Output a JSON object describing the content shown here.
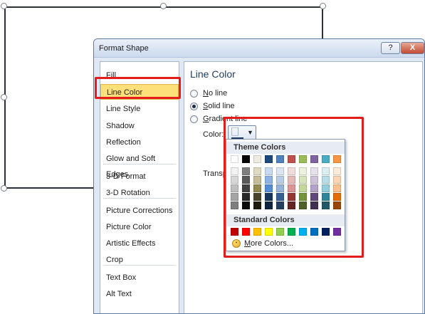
{
  "dialog": {
    "title": "Format Shape",
    "help_label": "?",
    "close_label": "X"
  },
  "nav": {
    "items": [
      {
        "label": "Fill"
      },
      {
        "label": "Line Color",
        "selected": true
      },
      {
        "label": "Line Style"
      },
      {
        "label": "Shadow"
      },
      {
        "label": "Reflection"
      },
      {
        "label": "Glow and Soft Edges"
      },
      {
        "label": "3-D Format"
      },
      {
        "label": "3-D Rotation"
      },
      {
        "label": "Picture Corrections"
      },
      {
        "label": "Picture Color"
      },
      {
        "label": "Artistic Effects"
      },
      {
        "label": "Crop"
      },
      {
        "label": "Text Box"
      },
      {
        "label": "Alt Text"
      }
    ]
  },
  "panel": {
    "title": "Line Color",
    "options": [
      {
        "key": "N",
        "rest": "o line",
        "checked": false
      },
      {
        "key": "S",
        "rest": "olid line",
        "checked": true
      },
      {
        "key": "G",
        "rest": "radient line",
        "checked": false
      }
    ],
    "color_label": "Color:",
    "color_value": "#1f3864",
    "transparency_label": "Transpa"
  },
  "palette": {
    "theme_header": "Theme Colors",
    "theme_top": [
      "#ffffff",
      "#000000",
      "#eeece1",
      "#1f497d",
      "#4f81bd",
      "#c0504d",
      "#9bbb59",
      "#8064a2",
      "#4bacc6",
      "#f79646"
    ],
    "theme_columns": [
      [
        "#f2f2f2",
        "#d8d8d8",
        "#bfbfbf",
        "#a5a5a5",
        "#7f7f7f"
      ],
      [
        "#7f7f7f",
        "#595959",
        "#3f3f3f",
        "#262626",
        "#0c0c0c"
      ],
      [
        "#ddd9c3",
        "#c4bd97",
        "#938953",
        "#494429",
        "#1d1b10"
      ],
      [
        "#c6d9f0",
        "#8db3e2",
        "#548dd4",
        "#17365d",
        "#0f243e"
      ],
      [
        "#dbe5f1",
        "#b8cce4",
        "#95b3d7",
        "#366092",
        "#244061"
      ],
      [
        "#f2dcdb",
        "#e5b9b7",
        "#d99694",
        "#953734",
        "#632423"
      ],
      [
        "#ebf1dd",
        "#d7e3bc",
        "#c3d69b",
        "#76923c",
        "#4f6128"
      ],
      [
        "#e5e0ec",
        "#ccc1d9",
        "#b2a2c7",
        "#5f497a",
        "#3f3151"
      ],
      [
        "#dbeef3",
        "#b7dde8",
        "#92cddc",
        "#31859b",
        "#205867"
      ],
      [
        "#fdeada",
        "#fbd5b5",
        "#fac08f",
        "#e36c09",
        "#974806"
      ]
    ],
    "standard_header": "Standard Colors",
    "standard": [
      "#c00000",
      "#ff0000",
      "#ffc000",
      "#ffff00",
      "#92d050",
      "#00b050",
      "#00b0f0",
      "#0070c0",
      "#002060",
      "#7030a0"
    ],
    "more_key": "M",
    "more_rest": "ore Colors..."
  },
  "annotations": {
    "highlight_color": "#e31c1c"
  }
}
